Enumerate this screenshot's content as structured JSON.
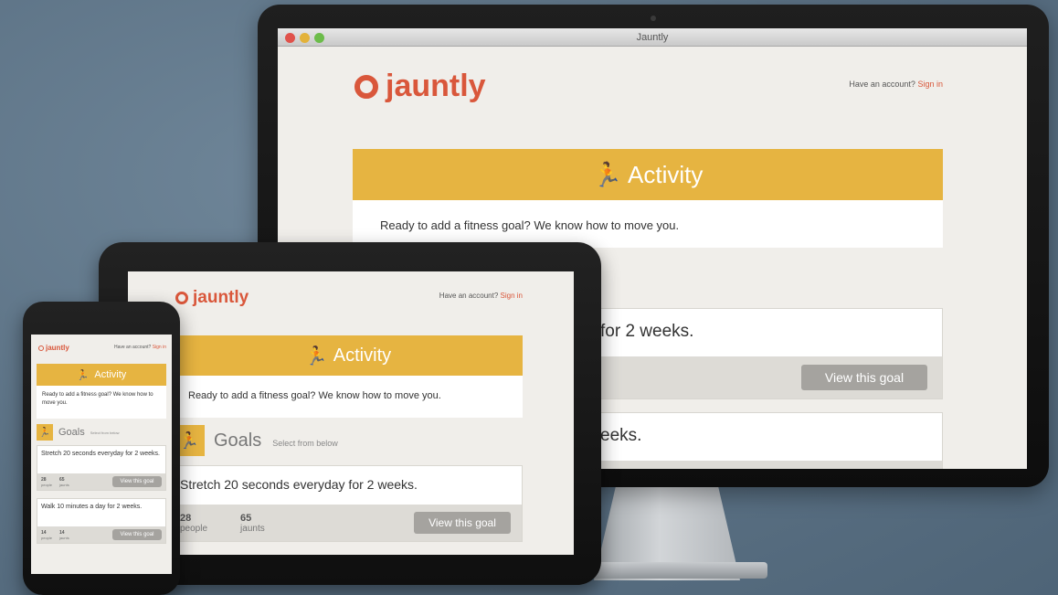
{
  "window": {
    "title": "Jauntly"
  },
  "brand": {
    "name": "jauntly",
    "color": "#d9573b"
  },
  "colors": {
    "accent": "#e6b441",
    "button": "#a5a39f",
    "background": "#f0eeea"
  },
  "header": {
    "account_prompt": "Have an account?",
    "signin_label": "Sign in"
  },
  "activity": {
    "icon": "runner-icon",
    "title": "Activity",
    "message": "Ready to add a fitness goal? We know how to move you."
  },
  "goals": {
    "icon": "runner-icon",
    "title": "Goals",
    "subtitle": "Select from below",
    "view_label": "View this goal",
    "items": [
      {
        "text": "Stretch 20 seconds everyday for 2 weeks.",
        "people": "28",
        "people_label": "people",
        "jaunts": "65",
        "jaunts_label": "jaunts"
      },
      {
        "text": "Walk 10 minutes a day for 2 weeks.",
        "people": "14",
        "people_label": "people",
        "jaunts": "14",
        "jaunts_label": "jaunts"
      }
    ]
  },
  "monitor_partial": {
    "goal1_tail": "for 2 weeks.",
    "goal2_tail": "eeks."
  }
}
